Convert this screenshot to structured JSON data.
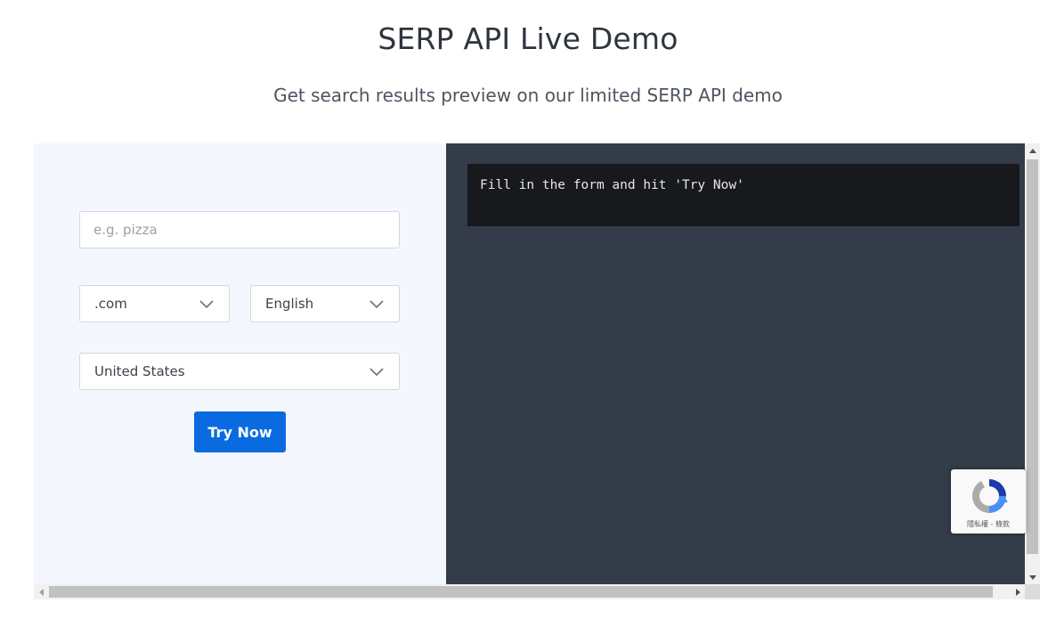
{
  "header": {
    "title": "SERP API Live Demo",
    "subtitle": "Get search results preview on our limited SERP API demo"
  },
  "form": {
    "query": {
      "value": "",
      "placeholder": "e.g. pizza"
    },
    "domain": {
      "selected": ".com"
    },
    "language": {
      "selected": "English"
    },
    "country": {
      "selected": "United States"
    },
    "submit_label": "Try Now"
  },
  "output": {
    "console_text": "Fill in the form and hit 'Try Now'"
  },
  "recaptcha": {
    "label": "隱私權 - 條款"
  },
  "colors": {
    "accent": "#0a6be0",
    "form_bg": "#f4f7fd",
    "output_bg": "#333c48",
    "console_bg": "#17191c"
  },
  "icons": {
    "select_chevron": "chevron-down-icon",
    "recaptcha": "recaptcha-logo-icon"
  }
}
